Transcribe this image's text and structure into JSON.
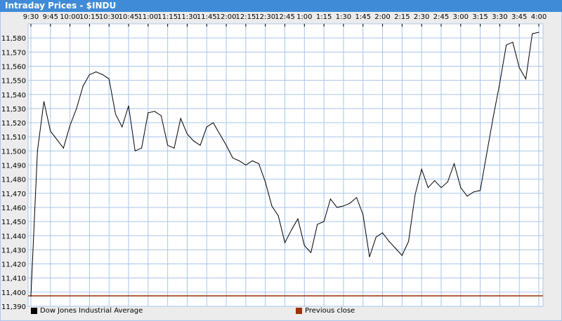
{
  "window": {
    "title": "Intraday Prices - $INDU"
  },
  "chart_data": {
    "type": "line",
    "title": "Intraday Prices - $INDU",
    "x_tick_labels": [
      "9:30",
      "9:45",
      "10:00",
      "10:15",
      "10:30",
      "10:45",
      "11:00",
      "11:15",
      "11:30",
      "11:45",
      "12:00",
      "12:15",
      "12:30",
      "12:45",
      "1:00",
      "1:15",
      "1:30",
      "1:45",
      "2:00",
      "2:15",
      "2:30",
      "2:45",
      "3:00",
      "3:15",
      "3:30",
      "3:45",
      "4:00"
    ],
    "y_tick_labels": [
      "11,390",
      "11,400",
      "11,410",
      "11,420",
      "11,430",
      "11,440",
      "11,450",
      "11,460",
      "11,470",
      "11,480",
      "11,490",
      "11,500",
      "11,510",
      "11,520",
      "11,530",
      "11,540",
      "11,550",
      "11,560",
      "11,570",
      "11,580"
    ],
    "ylim": [
      11390,
      11590
    ],
    "x_interval_minutes": 5,
    "grid": true,
    "legend_position": "bottom",
    "series": [
      {
        "name": "Dow Jones Industrial Average",
        "color": "#000000",
        "values": [
          11397,
          11500,
          11535,
          11514,
          11508,
          11502,
          11518,
          11530,
          11546,
          11554,
          11556,
          11554,
          11551,
          11526,
          11517,
          11532,
          11500,
          11502,
          11527,
          11528,
          11525,
          11504,
          11502,
          11523,
          11512,
          11507,
          11504,
          11517,
          11520,
          11512,
          11504,
          11495,
          11493,
          11490,
          11493,
          11491,
          11478,
          11461,
          11454,
          11435,
          11444,
          11452,
          11433,
          11428,
          11448,
          11450,
          11466,
          11460,
          11461,
          11463,
          11467,
          11455,
          11425,
          11439,
          11442,
          11436,
          11431,
          11426,
          11436,
          11469,
          11487,
          11474,
          11479,
          11474,
          11478,
          11491,
          11474,
          11468,
          11471,
          11472,
          11498,
          11524,
          11548,
          11575,
          11577,
          11559,
          11551,
          11583,
          11584
        ]
      },
      {
        "name": "Previous close",
        "color": "#993300",
        "value": 11397.4
      }
    ]
  }
}
